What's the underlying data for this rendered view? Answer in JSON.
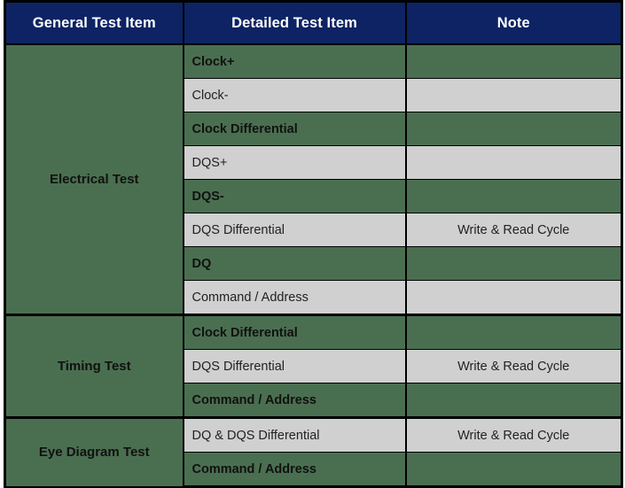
{
  "table": {
    "columns": [
      {
        "key": "general",
        "label": "General Test Item"
      },
      {
        "key": "detailed",
        "label": "Detailed Test Item"
      },
      {
        "key": "note",
        "label": "Note"
      }
    ],
    "colors": {
      "header_background": "#0D2363",
      "header_text": "#FFFFFF",
      "band_green": "#4A6F50",
      "band_gray": "#D0D0D0",
      "border": "#000000",
      "body_text": "#1A1A1A"
    },
    "groups": [
      {
        "label": "Electrical Test",
        "rows": [
          {
            "detailed": "Clock+",
            "note": "",
            "band": "green"
          },
          {
            "detailed": "Clock-",
            "note": "",
            "band": "gray"
          },
          {
            "detailed": "Clock Differential",
            "note": "",
            "band": "green"
          },
          {
            "detailed": "DQS+",
            "note": "",
            "band": "gray"
          },
          {
            "detailed": "DQS-",
            "note": "",
            "band": "green"
          },
          {
            "detailed": "DQS Differential",
            "note": "Write & Read Cycle",
            "band": "gray"
          },
          {
            "detailed": "DQ",
            "note": "",
            "band": "green"
          },
          {
            "detailed": "Command / Address",
            "note": "",
            "band": "gray"
          }
        ]
      },
      {
        "label": "Timing Test",
        "rows": [
          {
            "detailed": "Clock Differential",
            "note": "",
            "band": "green"
          },
          {
            "detailed": "DQS Differential",
            "note": "Write & Read Cycle",
            "band": "gray"
          },
          {
            "detailed": "Command / Address",
            "note": "",
            "band": "green"
          }
        ]
      },
      {
        "label": "Eye Diagram Test",
        "rows": [
          {
            "detailed": "DQ & DQS Differential",
            "note": "Write & Read Cycle",
            "band": "gray"
          },
          {
            "detailed": "Command / Address",
            "note": "",
            "band": "green"
          }
        ]
      }
    ]
  }
}
